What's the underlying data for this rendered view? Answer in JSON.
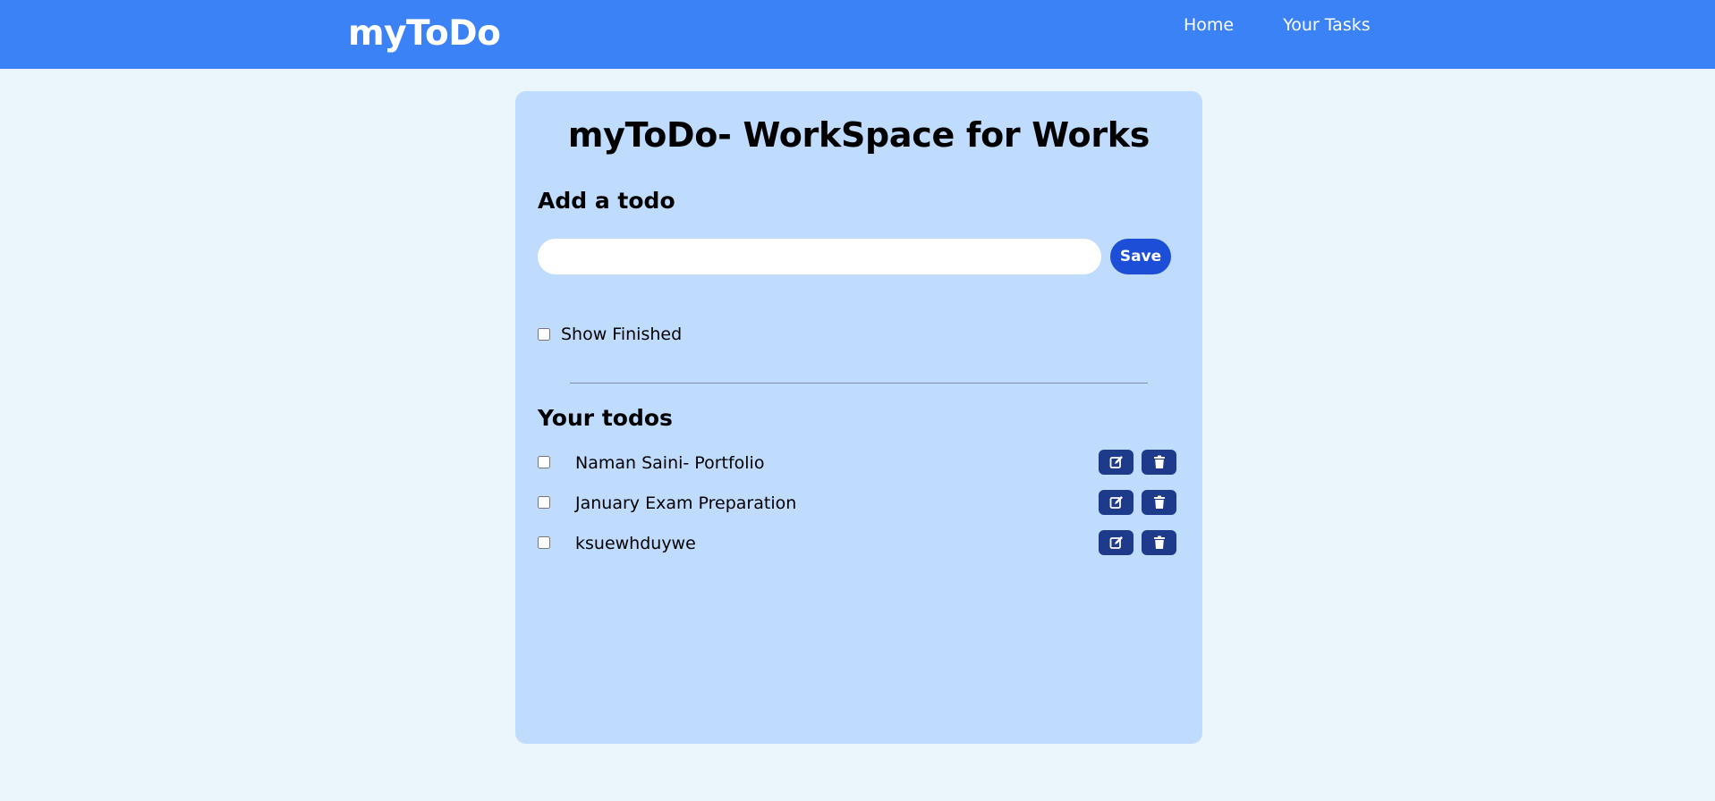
{
  "navbar": {
    "brand": "myToDo",
    "links": [
      {
        "label": "Home"
      },
      {
        "label": "Your Tasks"
      }
    ],
    "background": "#3b82f6"
  },
  "card": {
    "title": "myToDo- WorkSpace for Works",
    "add_heading": "Add a todo",
    "input": {
      "value": "",
      "placeholder": ""
    },
    "save_label": "Save",
    "show_finished": {
      "label": "Show Finished",
      "checked": false
    },
    "todos_heading": "Your todos",
    "todos": [
      {
        "text": "Naman Saini- Portfolio",
        "done": false,
        "edit_icon": "edit-icon",
        "delete_icon": "trash-icon"
      },
      {
        "text": "January Exam Preparation",
        "done": false,
        "edit_icon": "edit-icon",
        "delete_icon": "trash-icon"
      },
      {
        "text": "ksuewhduywe",
        "done": false,
        "edit_icon": "edit-icon",
        "delete_icon": "trash-icon"
      }
    ]
  },
  "colors": {
    "page_bg": "#eaf5fc",
    "card_bg": "#bfdbfe",
    "save_button": "#1d4ed8",
    "action_button": "#1e3a8a"
  }
}
